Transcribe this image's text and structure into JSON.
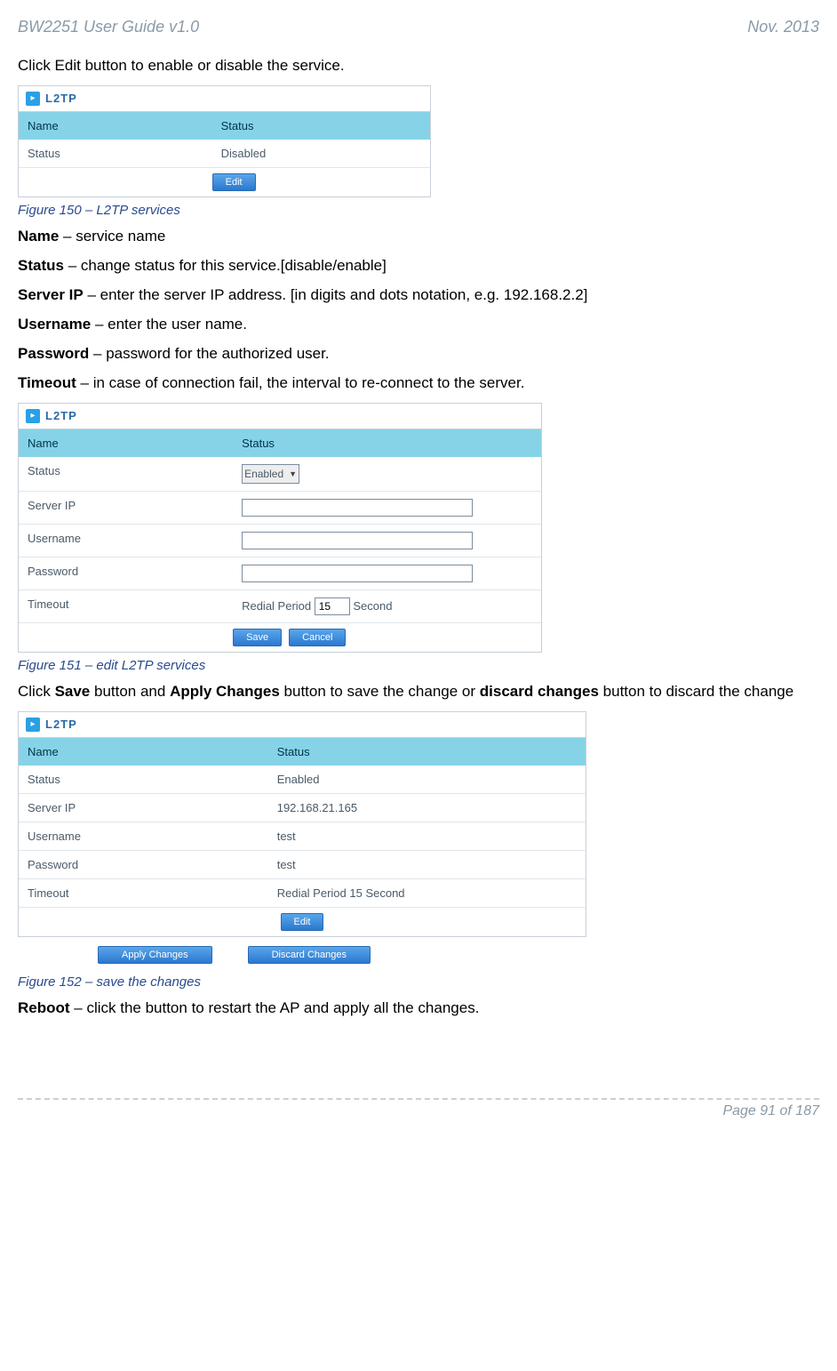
{
  "header": {
    "left": "BW2251 User Guide v1.0",
    "right": "Nov.  2013"
  },
  "intro_line": "Click Edit button to enable or disable the service.",
  "fig150": {
    "title": "L2TP",
    "head_a": "Name",
    "head_b": "Status",
    "row_a": "Status",
    "row_b": "Disabled",
    "edit_btn": "Edit",
    "caption": "Figure 150 – L2TP services"
  },
  "defs": {
    "name_k": "Name",
    "name_v": " – service name",
    "status_k": "Status",
    "status_v": " – change status for this service.[disable/enable]",
    "server_k": "Server IP",
    "server_v": " – enter the server IP address. [in digits and dots notation, e.g. 192.168.2.2]",
    "user_k": "Username",
    "user_v": " – enter the user name.",
    "pass_k": "Password",
    "pass_v": " – password for the authorized user.",
    "time_k": "Timeout",
    "time_v": " – in case of connection fail, the interval to re-connect to the server."
  },
  "fig151": {
    "title": "L2TP",
    "head_a": "Name",
    "head_b": "Status",
    "r1a": "Status",
    "r1b_sel": "Enabled",
    "r2a": "Server IP",
    "r2b_val": "",
    "r3a": "Username",
    "r3b_val": "",
    "r4a": "Password",
    "r4b_val": "",
    "r5a": "Timeout",
    "r5b_prefix": "Redial Period ",
    "r5b_val": "15",
    "r5b_suffix": "  Second",
    "save_btn": "Save",
    "cancel_btn": "Cancel",
    "caption": "Figure 151 – edit L2TP services"
  },
  "save_line_pre": "Click ",
  "save_line_b1": "Save",
  "save_line_mid1": " button and ",
  "save_line_b2": "Apply Changes",
  "save_line_mid2": " button to save the change or ",
  "save_line_b3": "discard changes",
  "save_line_post": " button to discard the change",
  "fig152": {
    "title": "L2TP",
    "head_a": "Name",
    "head_b": "Status",
    "r1a": "Status",
    "r1b": "Enabled",
    "r2a": "Server IP",
    "r2b": "192.168.21.165",
    "r3a": "Username",
    "r3b": "test",
    "r4a": "Password",
    "r4b": "test",
    "r5a": "Timeout",
    "r5b": "Redial Period 15 Second",
    "edit_btn": "Edit",
    "apply_btn": "Apply Changes",
    "discard_btn": "Discard Changes",
    "caption": "Figure 152 – save the changes"
  },
  "reboot_k": "Reboot",
  "reboot_v": " – click the button to restart the AP and apply all the changes.",
  "footer": {
    "page": "Page 91 of 187"
  }
}
